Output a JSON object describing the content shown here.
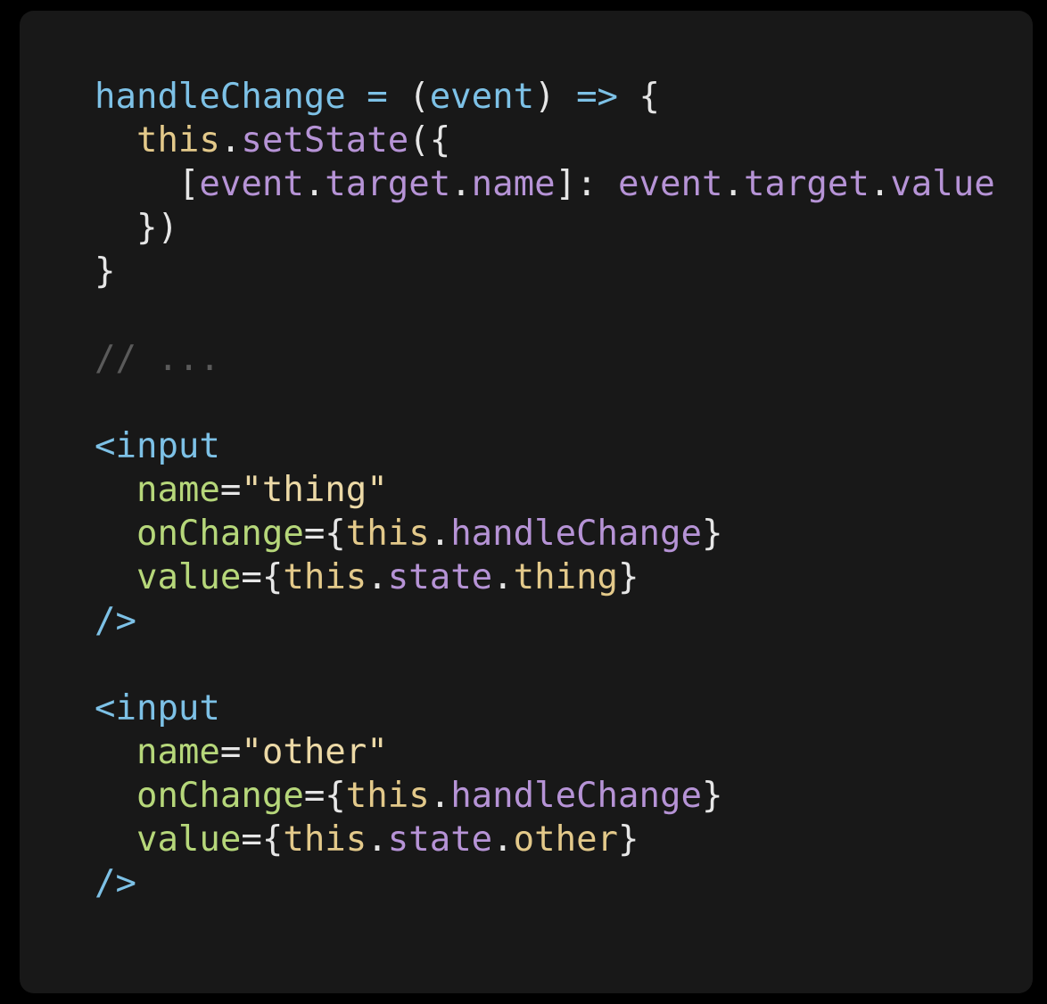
{
  "code": {
    "lines": [
      [
        {
          "t": "handleChange",
          "c": "method"
        },
        {
          "t": " = ",
          "c": "op"
        },
        {
          "t": "(",
          "c": "punct"
        },
        {
          "t": "event",
          "c": "method"
        },
        {
          "t": ") ",
          "c": "punct"
        },
        {
          "t": "=>",
          "c": "op"
        },
        {
          "t": " {",
          "c": "punct"
        }
      ],
      [
        {
          "t": "  ",
          "c": "punct"
        },
        {
          "t": "this",
          "c": "this"
        },
        {
          "t": ".",
          "c": "punct"
        },
        {
          "t": "setState",
          "c": "prop"
        },
        {
          "t": "({",
          "c": "punct"
        }
      ],
      [
        {
          "t": "    [",
          "c": "punct"
        },
        {
          "t": "event",
          "c": "prop"
        },
        {
          "t": ".",
          "c": "punct"
        },
        {
          "t": "target",
          "c": "prop"
        },
        {
          "t": ".",
          "c": "punct"
        },
        {
          "t": "name",
          "c": "prop"
        },
        {
          "t": "]: ",
          "c": "punct"
        },
        {
          "t": "event",
          "c": "prop"
        },
        {
          "t": ".",
          "c": "punct"
        },
        {
          "t": "target",
          "c": "prop"
        },
        {
          "t": ".",
          "c": "punct"
        },
        {
          "t": "value",
          "c": "prop"
        }
      ],
      [
        {
          "t": "  })",
          "c": "punct"
        }
      ],
      [
        {
          "t": "}",
          "c": "punct"
        }
      ],
      [],
      [
        {
          "t": "// ...",
          "c": "comment"
        }
      ],
      [],
      [
        {
          "t": "<input",
          "c": "tag"
        }
      ],
      [
        {
          "t": "  ",
          "c": "punct"
        },
        {
          "t": "name",
          "c": "attr"
        },
        {
          "t": "=",
          "c": "punct"
        },
        {
          "t": "\"thing\"",
          "c": "str"
        }
      ],
      [
        {
          "t": "  ",
          "c": "punct"
        },
        {
          "t": "onChange",
          "c": "attr"
        },
        {
          "t": "={",
          "c": "punct"
        },
        {
          "t": "this",
          "c": "this"
        },
        {
          "t": ".",
          "c": "punct"
        },
        {
          "t": "handleChange",
          "c": "prop"
        },
        {
          "t": "}",
          "c": "punct"
        }
      ],
      [
        {
          "t": "  ",
          "c": "punct"
        },
        {
          "t": "value",
          "c": "attr"
        },
        {
          "t": "={",
          "c": "punct"
        },
        {
          "t": "this",
          "c": "this"
        },
        {
          "t": ".",
          "c": "punct"
        },
        {
          "t": "state",
          "c": "prop"
        },
        {
          "t": ".",
          "c": "punct"
        },
        {
          "t": "thing",
          "c": "this"
        },
        {
          "t": "}",
          "c": "punct"
        }
      ],
      [
        {
          "t": "/>",
          "c": "tag"
        }
      ],
      [],
      [
        {
          "t": "<input",
          "c": "tag"
        }
      ],
      [
        {
          "t": "  ",
          "c": "punct"
        },
        {
          "t": "name",
          "c": "attr"
        },
        {
          "t": "=",
          "c": "punct"
        },
        {
          "t": "\"other\"",
          "c": "str"
        }
      ],
      [
        {
          "t": "  ",
          "c": "punct"
        },
        {
          "t": "onChange",
          "c": "attr"
        },
        {
          "t": "={",
          "c": "punct"
        },
        {
          "t": "this",
          "c": "this"
        },
        {
          "t": ".",
          "c": "punct"
        },
        {
          "t": "handleChange",
          "c": "prop"
        },
        {
          "t": "}",
          "c": "punct"
        }
      ],
      [
        {
          "t": "  ",
          "c": "punct"
        },
        {
          "t": "value",
          "c": "attr"
        },
        {
          "t": "={",
          "c": "punct"
        },
        {
          "t": "this",
          "c": "this"
        },
        {
          "t": ".",
          "c": "punct"
        },
        {
          "t": "state",
          "c": "prop"
        },
        {
          "t": ".",
          "c": "punct"
        },
        {
          "t": "other",
          "c": "this"
        },
        {
          "t": "}",
          "c": "punct"
        }
      ],
      [
        {
          "t": "/>",
          "c": "tag"
        }
      ]
    ]
  },
  "colors": {
    "background": "#000000",
    "panel": "#181818",
    "method": "#7dc1e6",
    "attr": "#b6d77a",
    "this": "#e3c98a",
    "prop": "#b693d6",
    "string": "#ecd9a6",
    "comment": "#5a5a5a"
  }
}
